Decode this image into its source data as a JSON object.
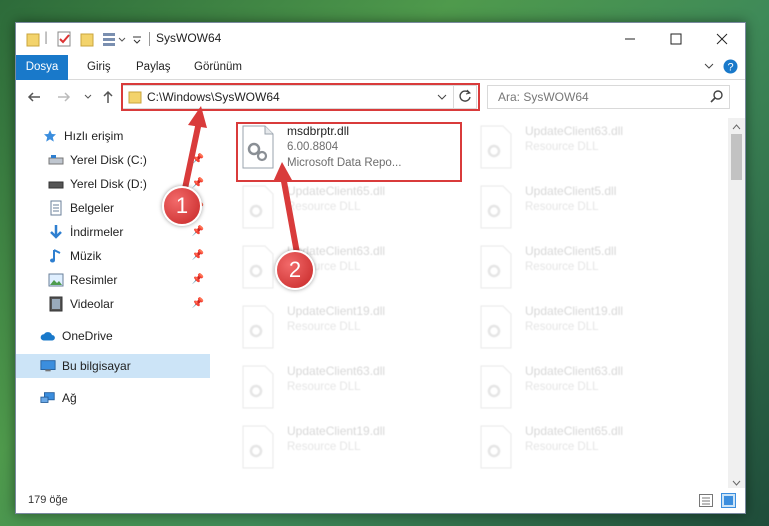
{
  "window": {
    "title": "SysWOW64"
  },
  "ribbon": {
    "tabs": [
      "Dosya",
      "Giriş",
      "Paylaş",
      "Görünüm"
    ]
  },
  "address": {
    "path": "C:\\Windows\\SysWOW64"
  },
  "search": {
    "placeholder": "Ara: SysWOW64"
  },
  "sidebar": {
    "items": [
      {
        "label": "Hızlı erişim",
        "icon": "star-icon"
      },
      {
        "label": "Yerel Disk (C:)",
        "icon": "drive-icon",
        "pinned": true
      },
      {
        "label": "Yerel Disk (D:)",
        "icon": "drive-icon",
        "pinned": true
      },
      {
        "label": "Belgeler",
        "icon": "document-icon",
        "pinned": true
      },
      {
        "label": "İndirmeler",
        "icon": "download-icon",
        "pinned": true
      },
      {
        "label": "Müzik",
        "icon": "music-icon",
        "pinned": true
      },
      {
        "label": "Resimler",
        "icon": "pictures-icon",
        "pinned": true
      },
      {
        "label": "Videolar",
        "icon": "video-icon",
        "pinned": true
      },
      {
        "label": "OneDrive",
        "icon": "cloud-icon"
      },
      {
        "label": "Bu bilgisayar",
        "icon": "computer-icon",
        "selected": true
      },
      {
        "label": "Ağ",
        "icon": "network-icon"
      }
    ]
  },
  "files": {
    "highlighted": {
      "name": "msdbrptr.dll",
      "version": "6.00.8804",
      "description": "Microsoft Data Repo..."
    },
    "left": [
      {
        "name": "UpdateClient65.dll",
        "type": "Resource DLL"
      },
      {
        "name": "UpdateClient63.dll",
        "type": "Resource DLL"
      },
      {
        "name": "UpdateClient19.dll",
        "type": "Resource DLL"
      },
      {
        "name": "UpdateClient63.dll",
        "type": "Resource DLL"
      },
      {
        "name": "UpdateClient19.dll",
        "type": "Resource DLL"
      }
    ],
    "right": [
      {
        "name": "UpdateClient63.dll",
        "type": "Resource DLL"
      },
      {
        "name": "UpdateClient5.dll",
        "type": "Resource DLL"
      },
      {
        "name": "UpdateClient5.dll",
        "type": "Resource DLL"
      },
      {
        "name": "UpdateClient19.dll",
        "type": "Resource DLL"
      },
      {
        "name": "UpdateClient63.dll",
        "type": "Resource DLL"
      },
      {
        "name": "UpdateClient65.dll",
        "type": "Resource DLL"
      }
    ]
  },
  "status": {
    "count": "179 öğe"
  },
  "annotations": {
    "step1": "1",
    "step2": "2",
    "color": "#d93b3b"
  }
}
